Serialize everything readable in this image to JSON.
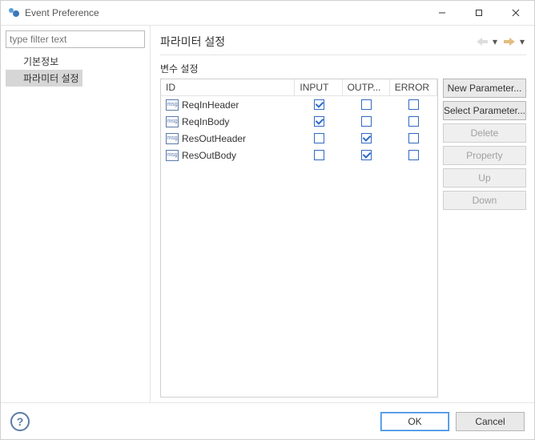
{
  "window": {
    "title": "Event Preference"
  },
  "filter": {
    "placeholder": "type filter text"
  },
  "tree": {
    "items": [
      {
        "label": "기본정보",
        "selected": false
      },
      {
        "label": "파라미터 설정",
        "selected": true
      }
    ]
  },
  "page": {
    "title": "파라미터 설정",
    "group_label": "변수 설정"
  },
  "table": {
    "columns": [
      {
        "label": "ID"
      },
      {
        "label": "INPUT"
      },
      {
        "label": "OUTP..."
      },
      {
        "label": "ERROR"
      }
    ],
    "rows": [
      {
        "id": "ReqInHeader",
        "input": true,
        "output": false,
        "error": false
      },
      {
        "id": "ReqInBody",
        "input": true,
        "output": false,
        "error": false
      },
      {
        "id": "ResOutHeader",
        "input": false,
        "output": true,
        "error": false
      },
      {
        "id": "ResOutBody",
        "input": false,
        "output": true,
        "error": false
      }
    ]
  },
  "side_buttons": {
    "new_parameter": "New Parameter...",
    "select_parameter": "Select Parameter...",
    "delete": "Delete",
    "property": "Property",
    "up": "Up",
    "down": "Down"
  },
  "footer": {
    "ok": "OK",
    "cancel": "Cancel"
  }
}
